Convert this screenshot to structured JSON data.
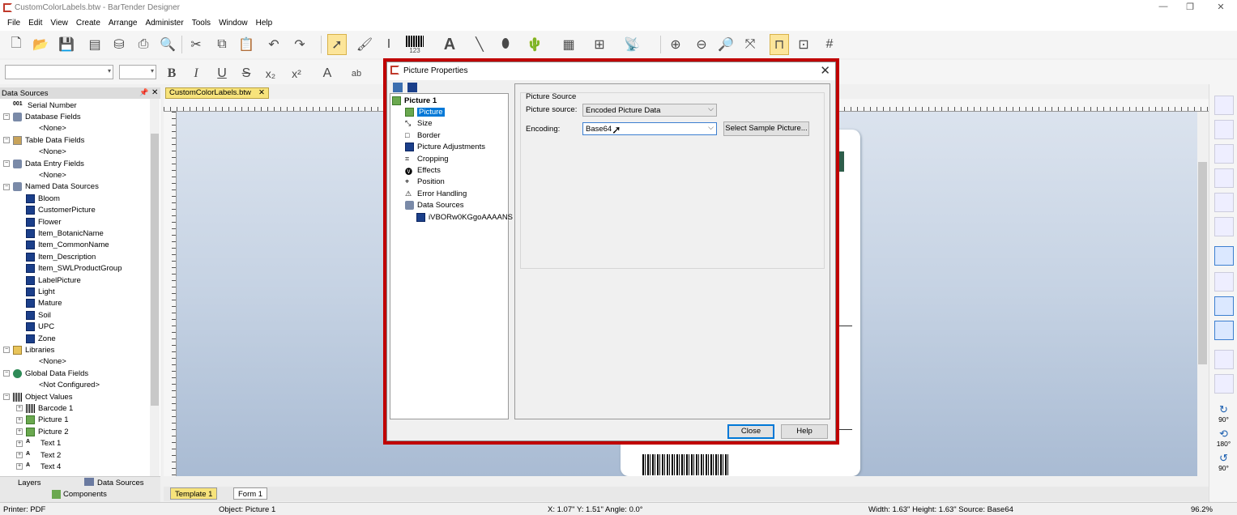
{
  "window": {
    "title": "CustomColorLabels.btw - BarTender Designer",
    "controls": [
      "—",
      "❐",
      "✕"
    ]
  },
  "menu": [
    "File",
    "Edit",
    "View",
    "Create",
    "Arrange",
    "Administer",
    "Tools",
    "Window",
    "Help"
  ],
  "format_toolbar": {
    "bold": "B",
    "italic": "I",
    "underline": "U",
    "strike": "S",
    "subscript": "x₂",
    "superscript": "x²",
    "font_color": "A",
    "highlight": "ab"
  },
  "toolbar_glyphs": {
    "barcode_caption": "123",
    "text_tool": "A"
  },
  "data_sources_panel": {
    "title": "Data Sources",
    "pin": "📌",
    "close": "✕",
    "items": [
      {
        "label": "Serial Number",
        "level": 0,
        "icon": "serial-number-icon",
        "expander": ""
      },
      {
        "label": "Database Fields",
        "level": 0,
        "icon": "database-icon",
        "expander": "−"
      },
      {
        "label": "<None>",
        "level": 2,
        "icon": "",
        "expander": ""
      },
      {
        "label": "Table Data Fields",
        "level": 0,
        "icon": "table-icon",
        "expander": "−"
      },
      {
        "label": "<None>",
        "level": 2,
        "icon": "",
        "expander": ""
      },
      {
        "label": "Data Entry Fields",
        "level": 0,
        "icon": "form-icon",
        "expander": "−"
      },
      {
        "label": "<None>",
        "level": 2,
        "icon": "",
        "expander": ""
      },
      {
        "label": "Named Data Sources",
        "level": 0,
        "icon": "named-data-icon",
        "expander": "−"
      },
      {
        "label": "Bloom",
        "level": 1,
        "icon": "data-source-icon",
        "expander": ""
      },
      {
        "label": "CustomerPicture",
        "level": 1,
        "icon": "data-source-icon",
        "expander": ""
      },
      {
        "label": "Flower",
        "level": 1,
        "icon": "data-source-icon",
        "expander": ""
      },
      {
        "label": "Item_BotanicName",
        "level": 1,
        "icon": "data-source-icon",
        "expander": ""
      },
      {
        "label": "Item_CommonName",
        "level": 1,
        "icon": "data-source-icon",
        "expander": ""
      },
      {
        "label": "Item_Description",
        "level": 1,
        "icon": "data-source-icon",
        "expander": ""
      },
      {
        "label": "Item_SWLProductGroup",
        "level": 1,
        "icon": "data-source-icon",
        "expander": ""
      },
      {
        "label": "LabelPicture",
        "level": 1,
        "icon": "data-source-icon",
        "expander": ""
      },
      {
        "label": "Light",
        "level": 1,
        "icon": "data-source-icon",
        "expander": ""
      },
      {
        "label": "Mature",
        "level": 1,
        "icon": "data-source-icon",
        "expander": ""
      },
      {
        "label": "Soil",
        "level": 1,
        "icon": "data-source-icon",
        "expander": ""
      },
      {
        "label": "UPC",
        "level": 1,
        "icon": "data-source-icon",
        "expander": ""
      },
      {
        "label": "Zone",
        "level": 1,
        "icon": "data-source-icon",
        "expander": ""
      },
      {
        "label": "Libraries",
        "level": 0,
        "icon": "library-icon",
        "expander": "−"
      },
      {
        "label": "<None>",
        "level": 2,
        "icon": "",
        "expander": ""
      },
      {
        "label": "Global Data Fields",
        "level": 0,
        "icon": "globe-icon",
        "expander": "−"
      },
      {
        "label": "<Not Configured>",
        "level": 2,
        "icon": "",
        "expander": ""
      },
      {
        "label": "Object Values",
        "level": 0,
        "icon": "barcode-icon",
        "expander": "−"
      },
      {
        "label": "Barcode 1",
        "level": 1,
        "icon": "barcode-icon",
        "expander": "+"
      },
      {
        "label": "Picture 1",
        "level": 1,
        "icon": "picture-icon",
        "expander": "+"
      },
      {
        "label": "Picture 2",
        "level": 1,
        "icon": "picture-icon",
        "expander": "+"
      },
      {
        "label": "Text 1",
        "level": 1,
        "icon": "text-icon",
        "expander": "+"
      },
      {
        "label": "Text 2",
        "level": 1,
        "icon": "text-icon",
        "expander": "+"
      },
      {
        "label": "Text 4",
        "level": 1,
        "icon": "text-icon",
        "expander": "+"
      }
    ]
  },
  "bottom_tabs": {
    "layers": "Layers",
    "data_sources": "Data Sources",
    "components": "Components"
  },
  "document_tab": {
    "label": "CustomColorLabels.btw",
    "close": "✕"
  },
  "page_tabs": {
    "template": "Template 1",
    "form": "Form 1"
  },
  "right_toolbar": {
    "rotate_90": "90°",
    "rotate_180": "180°",
    "rotate_270": "90°"
  },
  "status_bar": {
    "printer": "Printer: PDF",
    "object": "Object: Picture 1",
    "position": "X: 1.07\"  Y: 1.51\"  Angle: 0.0°",
    "size": "Width: 1.63\"  Height: 1.63\"  Source: Base64",
    "zoom": "96.2%"
  },
  "dialog": {
    "title": "Picture Properties",
    "close": "✕",
    "tree": [
      {
        "label": "Picture 1",
        "level": 0,
        "icon": "picture-icon",
        "bold": true
      },
      {
        "label": "Picture",
        "level": 1,
        "icon": "picture-icon",
        "selected": true
      },
      {
        "label": "Size",
        "level": 1,
        "icon": "resize-icon"
      },
      {
        "label": "Border",
        "level": 1,
        "icon": "border-icon"
      },
      {
        "label": "Picture Adjustments",
        "level": 1,
        "icon": "adjustments-icon"
      },
      {
        "label": "Cropping",
        "level": 1,
        "icon": "crop-icon"
      },
      {
        "label": "Effects",
        "level": 1,
        "icon": "effects-icon"
      },
      {
        "label": "Position",
        "level": 1,
        "icon": "position-icon"
      },
      {
        "label": "Error Handling",
        "level": 1,
        "icon": "error-icon"
      },
      {
        "label": "Data Sources",
        "level": 1,
        "icon": "data-sources-icon"
      },
      {
        "label": "iVBORw0KGgoAAAANS",
        "level": 2,
        "icon": "data-source-icon"
      }
    ],
    "group_title": "Picture Source",
    "picture_source_label": "Picture source:",
    "picture_source_value": "Encoded Picture Data",
    "encoding_label": "Encoding:",
    "encoding_value": "Base64",
    "select_sample_button": "Select Sample Picture...",
    "close_button": "Close",
    "help_button": "Help"
  },
  "colors": {
    "highlight_border": "#c00000",
    "selection": "#0078d7"
  }
}
